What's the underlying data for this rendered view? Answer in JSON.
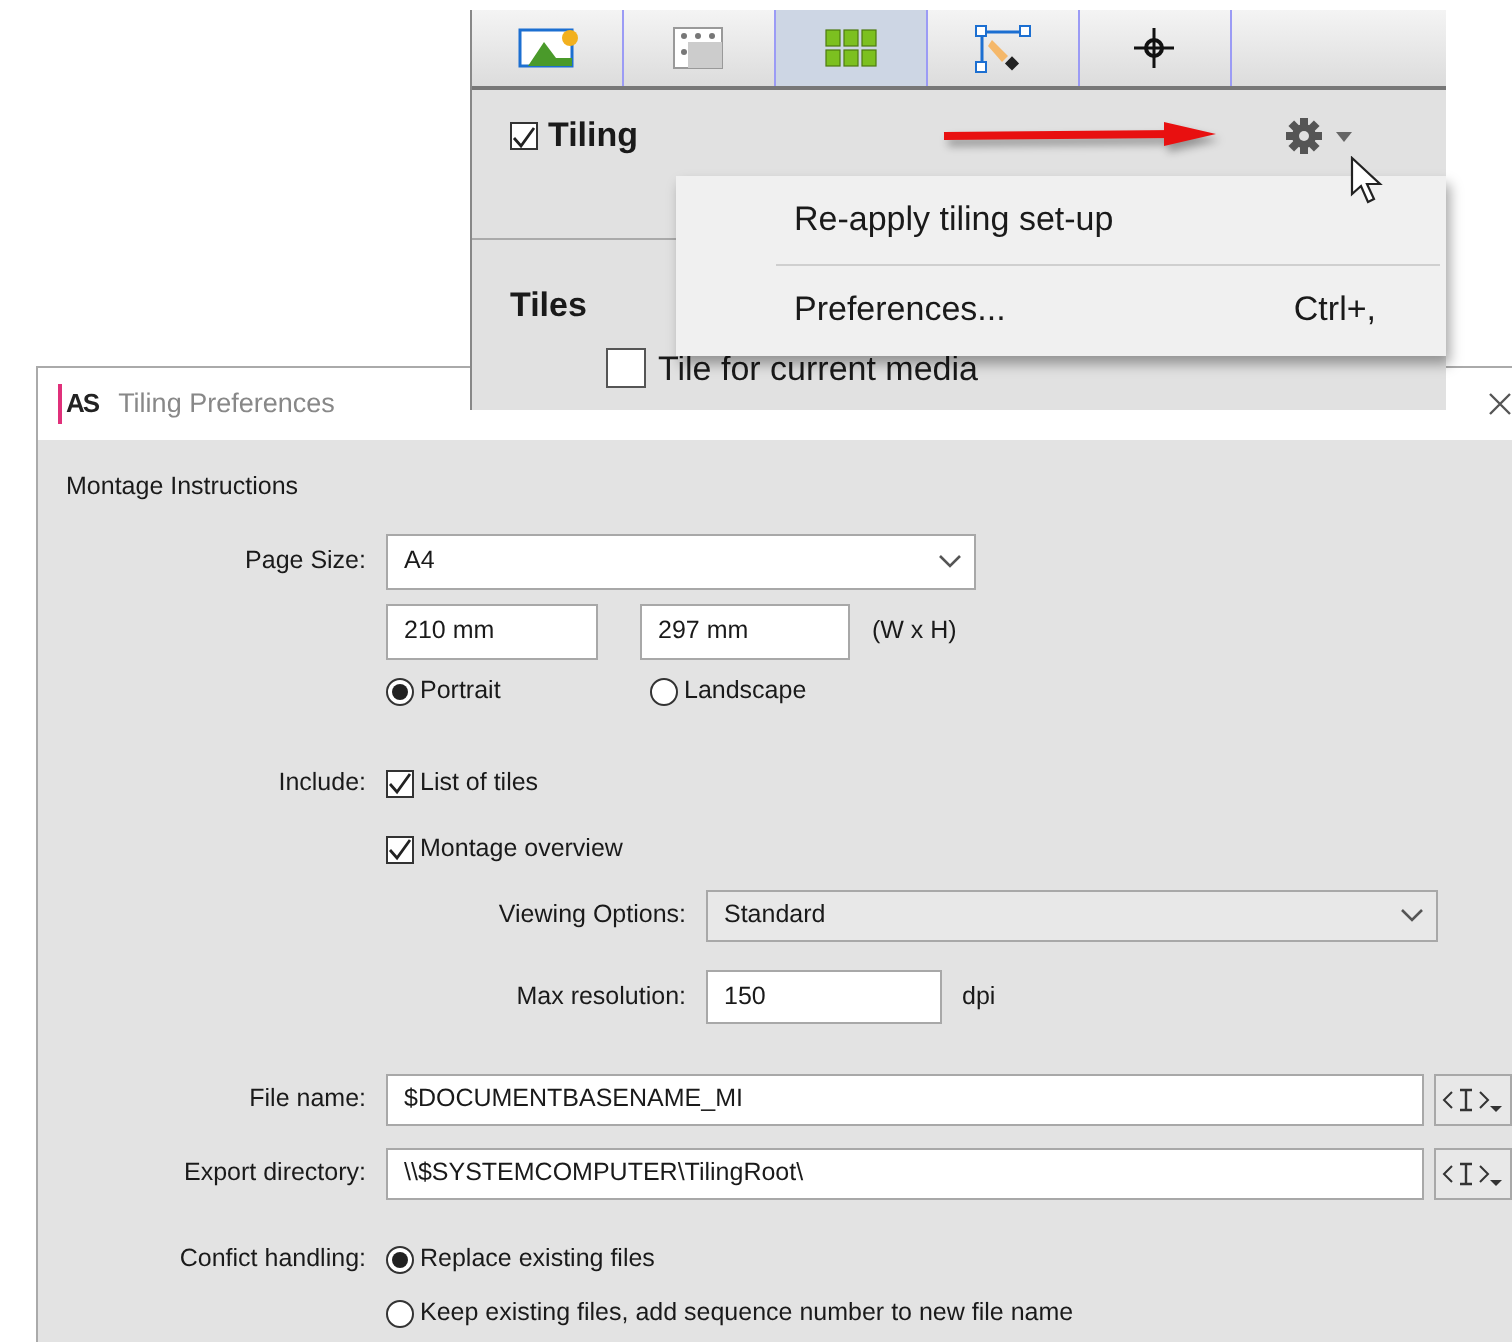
{
  "toolbar": {
    "tabs": [
      {
        "kind": "image",
        "selected": false
      },
      {
        "kind": "marks",
        "selected": false
      },
      {
        "kind": "grid",
        "selected": true
      },
      {
        "kind": "pen",
        "selected": false
      },
      {
        "kind": "crosshair",
        "selected": false
      }
    ]
  },
  "panel": {
    "title": "Tiling",
    "checked": true,
    "section": "Tiles",
    "option": {
      "label": "Tile for current media",
      "checked": false
    }
  },
  "menu": {
    "items": [
      {
        "label": "Re-apply tiling set-up"
      },
      {
        "label": "Preferences...",
        "shortcut": "Ctrl+,"
      }
    ]
  },
  "dialog": {
    "logo": "AS",
    "title": "Tiling Preferences",
    "section": "Montage Instructions",
    "page_size": {
      "label": "Page Size:",
      "value": "A4"
    },
    "width": "210 mm",
    "height": "297 mm",
    "dimension_hint": "(W x H)",
    "orientation": [
      {
        "label": "Portrait",
        "selected": true
      },
      {
        "label": "Landscape",
        "selected": false
      }
    ],
    "include": {
      "label": "Include:",
      "options": [
        {
          "label": "List of tiles",
          "checked": true
        },
        {
          "label": "Montage overview",
          "checked": true
        }
      ]
    },
    "viewing_options": {
      "label": "Viewing Options:",
      "value": "Standard"
    },
    "max_resolution": {
      "label": "Max resolution:",
      "value": "150",
      "unit": "dpi"
    },
    "file_name": {
      "label": "File name:",
      "value": "$DOCUMENTBASENAME_MI"
    },
    "export_directory": {
      "label": "Export directory:",
      "value": "\\\\$SYSTEMCOMPUTER\\TilingRoot\\"
    },
    "conflict": {
      "label": "Confict handling:",
      "options": [
        {
          "label": "Replace existing files",
          "selected": true
        },
        {
          "label": "Keep existing files, add sequence number to new file name",
          "selected": false
        }
      ]
    }
  }
}
